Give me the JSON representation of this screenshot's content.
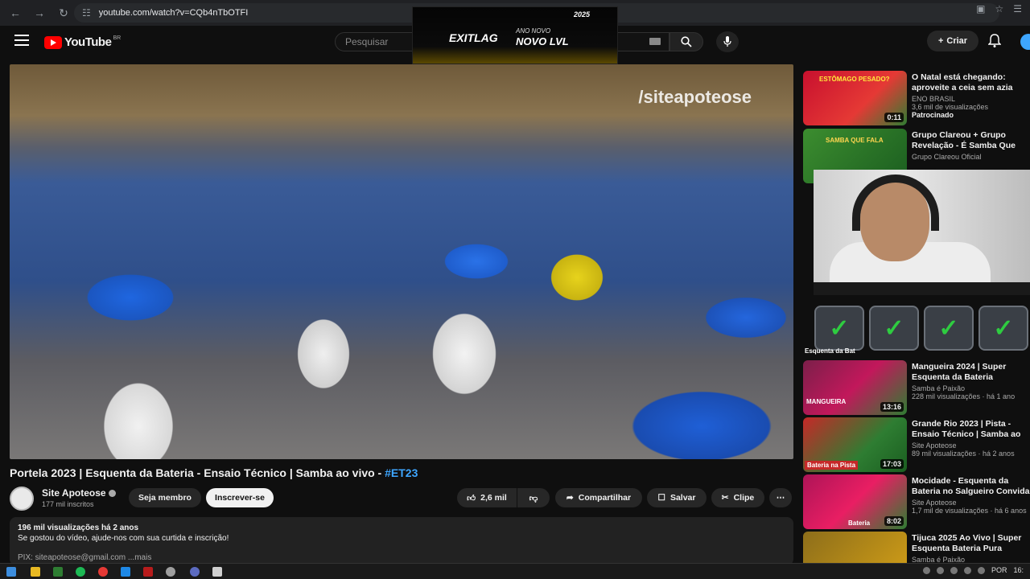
{
  "browser": {
    "url": "youtube.com/watch?v=CQb4nTbOTFI",
    "back_icon": "back-arrow-icon",
    "reload_icon": "reload-icon"
  },
  "header": {
    "logo_text": "YouTube",
    "country_code": "BR",
    "search_placeholder": "Pesquisar",
    "create_label": "Criar"
  },
  "ad": {
    "brand": "EXITLAG",
    "tagline_top": "ANO NOVO",
    "tagline_main": "NOVO LVL",
    "year": "2025"
  },
  "video": {
    "watermark": "/siteapoteose",
    "title_main": "Portela 2023 | Esquenta da Bateria - Ensaio Técnico | Samba ao vivo - ",
    "title_tag": "#ET23"
  },
  "channel": {
    "name": "Site Apoteose",
    "subscribers": "177 mil inscritos",
    "member_label": "Seja membro",
    "subscribe_label": "Inscrever-se"
  },
  "actions": {
    "likes": "2,6 mil",
    "share_label": "Compartilhar",
    "save_label": "Salvar",
    "clip_label": "Clipe"
  },
  "description": {
    "stats": "196 mil visualizações  há 2 anos",
    "line1": "Se gostou do vídeo, ajude-nos com sua curtida e inscrição!",
    "line2": "PIX: siteapoteose@gmail.com   ...mais"
  },
  "sidebar": {
    "items": [
      {
        "title": "O Natal está chegando: aproveite a ceia sem azia com",
        "channel": "ENO BRASIL",
        "views": "3,6 mil de visualizações",
        "extra": "Patrocinado",
        "duration": "0:11",
        "thumb_text": "ESTÔMAGO PESADO?",
        "color": "#c8102e"
      },
      {
        "title": "Grupo Clareou + Grupo Revelação - É Samba Que Fala",
        "channel": "Grupo Clareou Oficial",
        "views": "",
        "extra": "",
        "duration": "",
        "thumb_text": "SAMBA QUE FALA",
        "color": "#2e7d32"
      },
      {
        "title": "Mangueira 2024 | Super Esquenta da Bateria (Estandar",
        "channel": "Samba é Paixão",
        "views": "228 mil visualizações · há 1 ano",
        "extra": "",
        "duration": "13:16",
        "thumb_text": "MANGUEIRA",
        "color": "#c2185b"
      },
      {
        "title": "Grande Rio 2023 | Pista - Ensaio Técnico | Samba ao vivo - ...",
        "channel": "Site Apoteose",
        "views": "89 mil visualizações · há 2 anos",
        "extra": "",
        "duration": "17:03",
        "thumb_text": "Bateria na Pista",
        "color": "#2e7d32"
      },
      {
        "title": "Mocidade - Esquenta da Bateria no Salgueiro Convida - ...",
        "channel": "Site Apoteose",
        "views": "1,7 mil de visualizações · há 6 anos",
        "extra": "",
        "duration": "8:02",
        "thumb_text": "Bateria",
        "color": "#ad1457"
      },
      {
        "title": "Tijuca 2025 Ao Vivo | Super Esquenta Bateria Pura Cadênc",
        "channel": "Samba é Paixão",
        "views": "",
        "extra": "",
        "duration": "",
        "thumb_text": "",
        "color": "#8d6e1a"
      }
    ],
    "overlay_label": "Esquenta da Bat"
  },
  "taskbar": {
    "lang": "POR",
    "time": "16:"
  },
  "colors": {
    "accent": "#3ea6ff",
    "brand_red": "#ff0000",
    "check_green": "#2ecc40"
  }
}
